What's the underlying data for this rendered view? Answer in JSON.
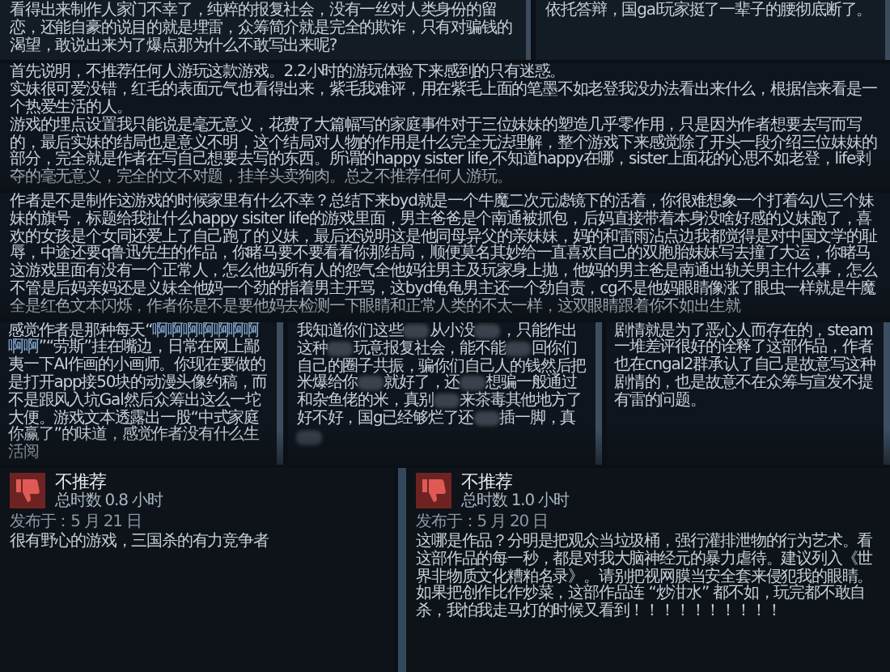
{
  "top_reviews": [
    {
      "text": "看得出来制作人家门不幸了，纯粹的报复社会，没有一丝对人类身份的留恋，还能自豪的说目的就是埋雷，众筹简介就是完全的欺诈，只有对骗钱的渴望，敢说出来为了爆点那为什么不敢写出来呢?"
    },
    {
      "text": "依托答辩，国gal玩家挺了一辈子的腰彻底断了。"
    }
  ],
  "long_reviews": [
    {
      "paragraphs": [
        "首先说明，不推荐任何人游玩这款游戏。2.2小时的游玩体验下来感到的只有迷惑。",
        "实妹很可爱没错，红毛的表面元气也看得出来，紫毛我难评，用在紫毛上面的笔墨不如老登我没办法看出来什么，根据信来看是一个热爱生活的人。",
        "游戏的埋点设置我只能说是毫无意义，花费了大篇幅写的家庭事件对于三位妹妹的塑造几乎零作用，只是因为作者想要去写而写的，最后实妹的结局也是意义不明，这个结局对人物的作用是什么完全无法理解，整个游戏下来感觉除了开头一段介绍三位妹妹的部分，完全就是作者在写自己想要去写的东西。所谓的happy sister life,不知道happy在哪，sister上面花的心思不如老登，life剥夺的毫无意义，完全的文不对题，挂羊头卖狗肉。总之不推荐任何人游玩。"
      ]
    },
    {
      "paragraphs": [
        "作者是不是制作这游戏的时候家里有什么不幸？总结下来byd就是一个牛魔二次元滤镜下的活着，你很难想象一个打着勾八三个妹妹的旗号，标题给我扯什么happy sisiter life的游戏里面，男主爸爸是个南通被抓包，后妈直接带着本身没啥好感的义妹跑了，喜欢的女孩是个女同还爱上了自己跑了的义妹，最后还说明这是他同母异父的亲妹妹，妈的和雷雨沾点边我都觉得是对中国文学的耻辱，中途还要q鲁迅先生的作品，你睹马要不要看看你那结局，顺便莫名其妙给一直喜欢自己的双胞胎妹妹写去撞了大运，你睹马这游戏里面有没有一个正常人，怎么他妈所有人的怨气全他妈往男主及玩家身上抛，他妈的男主爸是南通出轨关男主什么事，怎么不管是后妈亲妈还是义妹全他妈一个劲的指着男主开骂，这byd龟龟男主还一个劲自责，cg不是他妈眼睛像涨了眼虫一样就是牛魔全是红色文本闪烁，作者你是不是要他妈去检测一下眼睛和正常人类的不太一样，这双眼睛跟着你不如出生就"
      ]
    }
  ],
  "short_reviews": [
    {
      "segments": [
        {
          "kind": "text",
          "text": "感觉作者是那种每天“"
        },
        {
          "kind": "link",
          "text": "啊啊啊啊啊啊啊啊啊"
        },
        {
          "kind": "text",
          "text": "”“劳斯”挂在嘴边，日常在网上鄙夷一下AI作画的小画师。你现在要做的是打开app接50块的动漫头像约稿，而不是跟风入坑Gal然后众筹出这么一坨大便。游戏文本透露出一股“中式家庭你赢了”的味道，感觉作者没有什么生活阅"
        }
      ]
    },
    {
      "segments": [
        {
          "kind": "text",
          "text": "我知道你们这些"
        },
        {
          "kind": "censor"
        },
        {
          "kind": "text",
          "text": "从小没"
        },
        {
          "kind": "censor"
        },
        {
          "kind": "text",
          "text": "，只能作出这种"
        },
        {
          "kind": "censor"
        },
        {
          "kind": "text",
          "text": "玩意报复社会，能不能"
        },
        {
          "kind": "censor"
        },
        {
          "kind": "text",
          "text": "回你们自己的圈子共振，骗你们自己人的钱然后把米爆给你"
        },
        {
          "kind": "censor"
        },
        {
          "kind": "text",
          "text": "就好了，还"
        },
        {
          "kind": "censor"
        },
        {
          "kind": "text",
          "text": "想骗一般通过和杂鱼佬的米，真别"
        },
        {
          "kind": "censor"
        },
        {
          "kind": "text",
          "text": "来茶毒其他地方了好不好，国g已经够烂了还"
        },
        {
          "kind": "censor"
        },
        {
          "kind": "text",
          "text": "插一脚，真"
        },
        {
          "kind": "censor"
        }
      ]
    },
    {
      "segments": [
        {
          "kind": "text",
          "text": "剧情就是为了恶心人而存在的，steam一堆差评很好的诠释了这部作品，作者也在cngal2群承认了自己是故意写这种剧情的，也是故意不在众筹与宣发不提有雷的问题。"
        }
      ]
    }
  ],
  "reviews": [
    {
      "verdict": "不推荐",
      "recommended": false,
      "playtime": "总时数 0.8 小时",
      "posted": "发布于：5 月 21 日",
      "text": "很有野心的游戏，三国杀的有力竞争者"
    },
    {
      "verdict": "不推荐",
      "recommended": false,
      "playtime": "总时数 1.0 小时",
      "posted": "发布于：5 月 20 日",
      "text": "这哪是作品？分明是把观众当垃圾桶，强行灌排泄物的行为艺术。看这部作品的每一秒，都是对我大脑神经元的暴力虐待。建议列入《世界非物质文化糟粕名录》。请别把视网膜当安全套来侵犯我的眼睛。如果把创作比作炒菜，这部作品连 “炒泔水” 都不如，玩完都不敢自杀，我怕我走马灯的时候又看到！！！！！！！！！！"
    }
  ]
}
